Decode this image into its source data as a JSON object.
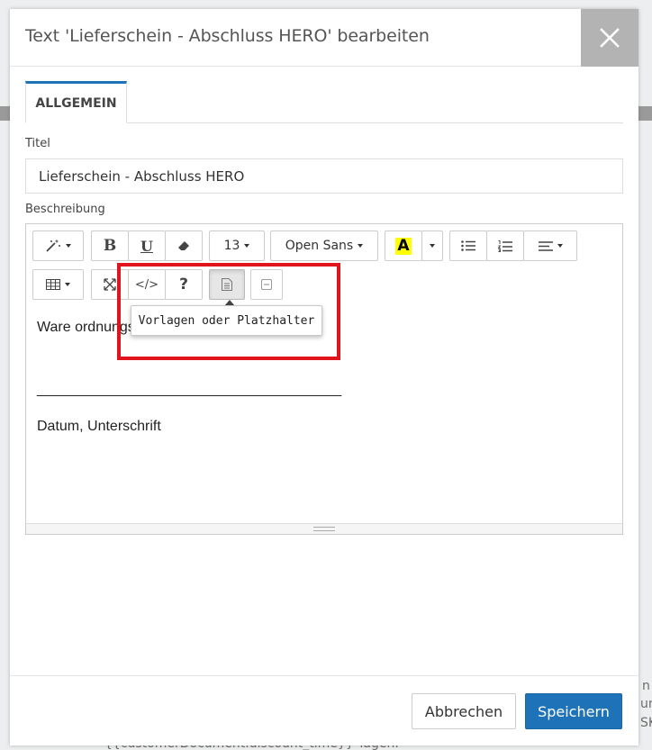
{
  "background": {
    "snippets": [
      "n",
      "un",
      "SK",
      "{{customerDocument.discount_time}} Tagen."
    ]
  },
  "modal": {
    "title": "Text 'Lieferschein - Abschluss HERO' bearbeiten",
    "close_icon": "close-icon",
    "tabs": [
      {
        "label": "ALLGEMEIN",
        "active": true
      }
    ],
    "fields": {
      "title_label": "Titel",
      "title_value": "Lieferschein - Abschluss HERO",
      "description_label": "Beschreibung"
    },
    "toolbar": {
      "style_icon": "magic-wand-icon",
      "bold": "B",
      "underline": "U",
      "eraser_icon": "eraser-icon",
      "font_size": "13",
      "font_name": "Open Sans",
      "color_letter": "A",
      "highlight_color": "#ffff00",
      "ul_icon": "unordered-list-icon",
      "ol_icon": "ordered-list-icon",
      "align_icon": "align-icon",
      "table_icon": "table-icon",
      "fullscreen_icon": "fullscreen-icon",
      "code": "</>",
      "help": "?",
      "template_icon": "document-icon",
      "placeholder_icon": "minus-box-icon"
    },
    "tooltip": "Vorlagen oder Platzhalter",
    "content": {
      "line1": "Ware ordnungsgemäß erhalten",
      "line2": "______________________________________",
      "line3": "Datum, Unterschrift"
    },
    "footer": {
      "cancel": "Abbrechen",
      "save": "Speichern"
    },
    "colors": {
      "primary": "#1e72b8",
      "highlight_frame": "#e0141c",
      "close_bg": "#b3b3b3"
    }
  }
}
